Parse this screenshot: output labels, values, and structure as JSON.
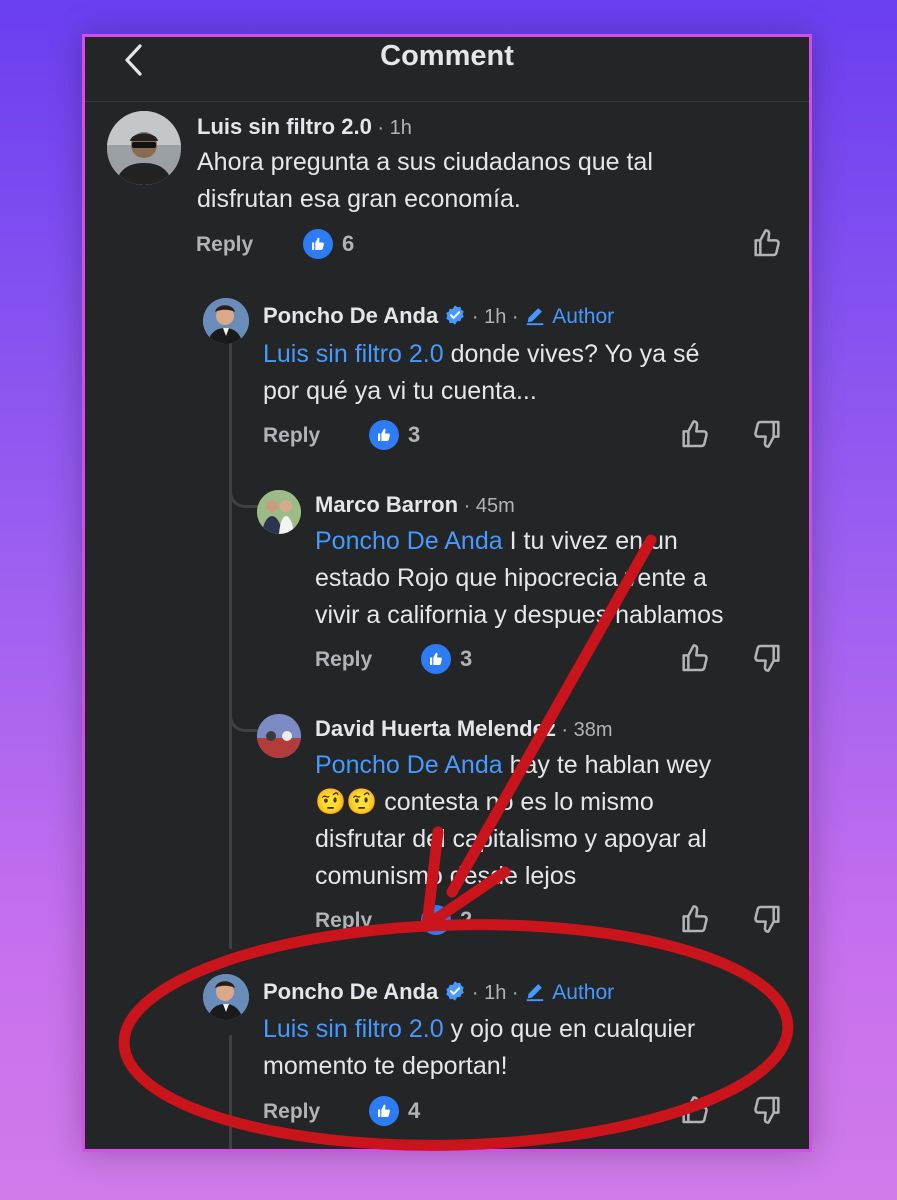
{
  "header": {
    "title": "Comment"
  },
  "comments": [
    {
      "author": "Luis sin filtro 2.0",
      "time": "1h",
      "lines": [
        "Ahora pregunta a sus ciudadanos que tal",
        "disfrutan esa gran economía."
      ],
      "reply_label": "Reply",
      "likes": "6"
    },
    {
      "author": "Poncho De Anda",
      "time": "1h",
      "author_badge": "Author",
      "mention": "Luis sin filtro 2.0",
      "line1_rest": " donde vives? Yo ya sé",
      "line2": "por qué ya vi tu cuenta...",
      "reply_label": "Reply",
      "likes": "3"
    },
    {
      "author": "Marco Barron",
      "time": "45m",
      "mention": "Poncho De Anda",
      "line1_rest": " I tu vivez en un",
      "line2": "estado Rojo que hipocrecia vente a",
      "line3": "vivir a california y despues hablamos",
      "reply_label": "Reply",
      "likes": "3"
    },
    {
      "author": "David Huerta Melendez",
      "time": "38m",
      "mention": "Poncho De Anda",
      "line1_rest": " hay te hablan wey",
      "line2_emoji": "🤨🤨",
      "line2_rest": " contesta no es lo mismo",
      "line3": "disfrutar del capitalismo y apoyar al",
      "line4": "comunismo desde lejos",
      "reply_label": "Reply",
      "likes": "2"
    },
    {
      "author": "Poncho De Anda",
      "time": "1h",
      "author_badge": "Author",
      "mention": "Luis sin filtro 2.0",
      "line1_rest": " y ojo que en cualquier",
      "line2": "momento te deportan!",
      "reply_label": "Reply",
      "likes": "4"
    }
  ],
  "icons": {
    "back": "chevron-left-icon",
    "like_badge": "thumbs-up-icon",
    "like": "thumbs-up-outline-icon",
    "dislike": "thumbs-down-outline-icon",
    "verified": "verified-badge-icon",
    "author": "pencil-icon"
  },
  "colors": {
    "background": "#242526",
    "text": "#e4e6eb",
    "muted": "#b0b3b8",
    "link": "#4599ff",
    "like_badge": "#2d7cf6",
    "annotation": "#c8141a",
    "frame_border": "#d14fe8"
  }
}
